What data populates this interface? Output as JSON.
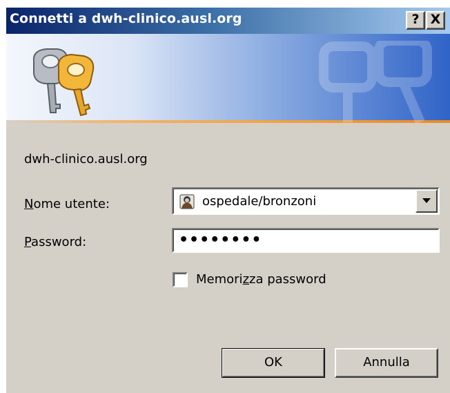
{
  "window": {
    "title": "Connetti a dwh-clinico.ausl.org",
    "help_button": "?",
    "close_button": "X"
  },
  "banner": {
    "icon": "keys-icon",
    "accent_color": "#f2a64a"
  },
  "server": "dwh-clinico.ausl.org",
  "username_field": {
    "label_accel": "N",
    "label_rest": "ome utente:",
    "value": "ospedale/bronzoni",
    "icon": "user-icon"
  },
  "password_field": {
    "label_accel": "P",
    "label_rest": "assword:",
    "value": "••••••••"
  },
  "remember": {
    "label_before": "Memori",
    "label_accel": "z",
    "label_after": "za password",
    "checked": false
  },
  "buttons": {
    "ok": "OK",
    "cancel": "Annulla"
  }
}
